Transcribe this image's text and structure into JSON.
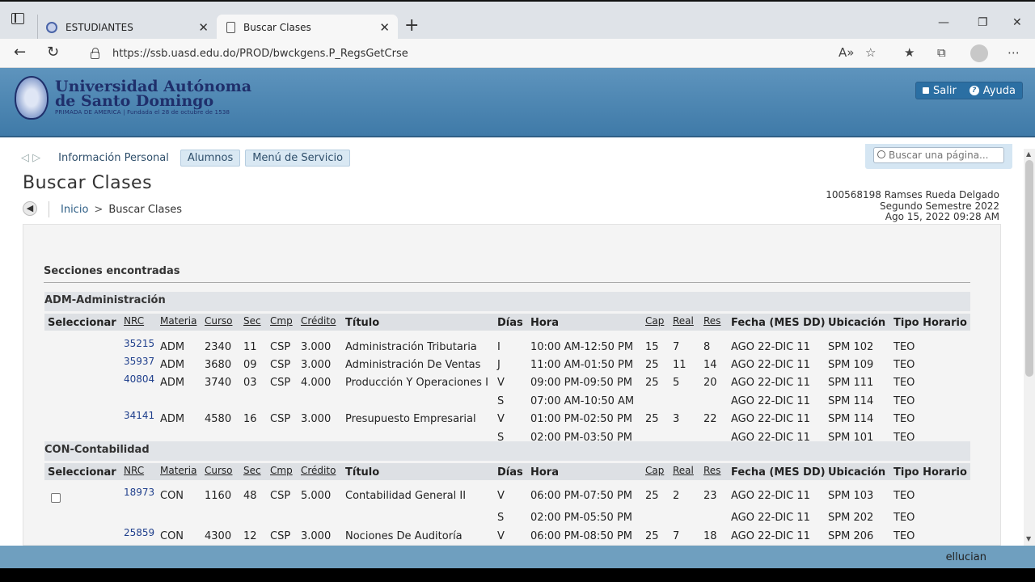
{
  "browser": {
    "tabs": [
      {
        "label": "ESTUDIANTES"
      },
      {
        "label": "Buscar Clases"
      }
    ],
    "url": "https://ssb.uasd.edu.do/PROD/bwckgens.P_RegsGetCrse"
  },
  "banner": {
    "line1": "Universidad Autónoma",
    "line2": "de Santo Domingo",
    "tagline": "PRIMADA DE AMERICA | Fundada el 28 de octubre de 1538",
    "logout": "Salir",
    "help": "Ayuda"
  },
  "menu": {
    "items": [
      "Información Personal",
      "Alumnos",
      "Menú de Servicio"
    ],
    "search_placeholder": "Buscar una página..."
  },
  "page": {
    "title": "Buscar Clases",
    "breadcrumb": [
      "Inicio",
      "Buscar Clases"
    ],
    "user": [
      "100568198 Ramses Rueda Delgado",
      "Segundo Semestre 2022",
      "Ago 15, 2022 09:28 AM"
    ],
    "sections_found": "Secciones encontradas"
  },
  "columns": [
    "Seleccionar",
    "NRC",
    "Materia",
    "Curso",
    "Sec",
    "Cmp",
    "Crédito",
    "Título",
    "Días",
    "Hora",
    "Cap",
    "Real",
    "Res",
    "Fecha (MES DD)",
    "Ubicación",
    "Tipo Horario"
  ],
  "subjects": [
    {
      "name": "ADM-Administración",
      "rows": [
        {
          "nrc": "35215",
          "materia": "ADM",
          "curso": "2340",
          "sec": "11",
          "cmp": "CSP",
          "credito": "3.000",
          "titulo": "Administración Tributaria",
          "dias": "I",
          "hora": "10:00 AM-12:50 PM",
          "cap": "15",
          "real": "7",
          "res": "8",
          "fecha": "AGO 22-DIC 11",
          "ubicacion": "SPM 102",
          "tipo": "TEO"
        },
        {
          "nrc": "35937",
          "materia": "ADM",
          "curso": "3680",
          "sec": "09",
          "cmp": "CSP",
          "credito": "3.000",
          "titulo": "Administración De Ventas",
          "dias": "J",
          "hora": "11:00 AM-01:50 PM",
          "cap": "25",
          "real": "11",
          "res": "14",
          "fecha": "AGO 22-DIC 11",
          "ubicacion": "SPM 109",
          "tipo": "TEO"
        },
        {
          "nrc": "40804",
          "materia": "ADM",
          "curso": "3740",
          "sec": "03",
          "cmp": "CSP",
          "credito": "4.000",
          "titulo": "Producción Y Operaciones I",
          "dias": "V",
          "hora": "09:00 PM-09:50 PM",
          "cap": "25",
          "real": "5",
          "res": "20",
          "fecha": "AGO 22-DIC 11",
          "ubicacion": "SPM 111",
          "tipo": "TEO"
        },
        {
          "dias": "S",
          "hora": "07:00 AM-10:50 AM",
          "fecha": "AGO 22-DIC 11",
          "ubicacion": "SPM 114",
          "tipo": "TEO"
        },
        {
          "nrc": "34141",
          "materia": "ADM",
          "curso": "4580",
          "sec": "16",
          "cmp": "CSP",
          "credito": "3.000",
          "titulo": "Presupuesto Empresarial",
          "dias": "V",
          "hora": "01:00 PM-02:50 PM",
          "cap": "25",
          "real": "3",
          "res": "22",
          "fecha": "AGO 22-DIC 11",
          "ubicacion": "SPM 114",
          "tipo": "TEO"
        },
        {
          "dias": "S",
          "hora": "02:00 PM-03:50 PM",
          "fecha": "AGO 22-DIC 11",
          "ubicacion": "SPM 101",
          "tipo": "TEO"
        }
      ]
    },
    {
      "name": "CON-Contabilidad",
      "rows": [
        {
          "checkbox": true,
          "nrc": "18973",
          "materia": "CON",
          "curso": "1160",
          "sec": "48",
          "cmp": "CSP",
          "credito": "5.000",
          "titulo": "Contabilidad General II",
          "dias": "V",
          "hora": "06:00 PM-07:50 PM",
          "cap": "25",
          "real": "2",
          "res": "23",
          "fecha": "AGO 22-DIC 11",
          "ubicacion": "SPM 103",
          "tipo": "TEO"
        },
        {
          "dias": "S",
          "hora": "02:00 PM-05:50 PM",
          "fecha": "AGO 22-DIC 11",
          "ubicacion": "SPM 202",
          "tipo": "TEO"
        },
        {
          "nrc": "25859",
          "materia": "CON",
          "curso": "4300",
          "sec": "12",
          "cmp": "CSP",
          "credito": "3.000",
          "titulo": "Nociones De Auditoría",
          "dias": "V",
          "hora": "06:00 PM-08:50 PM",
          "cap": "25",
          "real": "7",
          "res": "18",
          "fecha": "AGO 22-DIC 11",
          "ubicacion": "SPM 206",
          "tipo": "TEO"
        }
      ]
    }
  ],
  "footer": {
    "brand": "ellucian"
  }
}
